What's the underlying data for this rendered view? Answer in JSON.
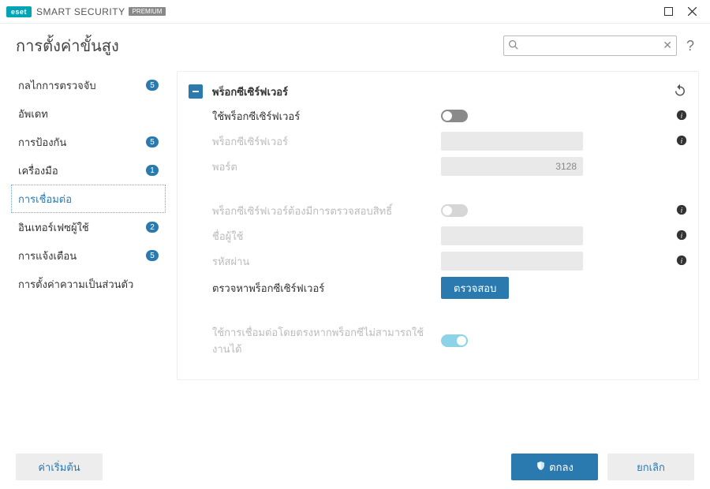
{
  "titlebar": {
    "logo": "eset",
    "product": "SMART SECURITY",
    "edition": "PREMIUM"
  },
  "header": {
    "title": "การตั้งค่าขั้นสูง",
    "search_placeholder": "",
    "help": "?"
  },
  "sidebar": {
    "items": [
      {
        "label": "กลไกการตรวจจับ",
        "badge": "5",
        "selected": false
      },
      {
        "label": "อัพเดท",
        "badge": null,
        "selected": false
      },
      {
        "label": "การป้องกัน",
        "badge": "5",
        "selected": false
      },
      {
        "label": "เครื่องมือ",
        "badge": "1",
        "selected": false
      },
      {
        "label": "การเชื่อมต่อ",
        "badge": null,
        "selected": true
      },
      {
        "label": "อินเทอร์เฟซผู้ใช้",
        "badge": "2",
        "selected": false
      },
      {
        "label": "การแจ้งเตือน",
        "badge": "5",
        "selected": false
      },
      {
        "label": "การตั้งค่าความเป็นส่วนตัว",
        "badge": null,
        "selected": false
      }
    ]
  },
  "section": {
    "title": "พร็อกซีเซิร์ฟเวอร์",
    "rows": {
      "use_proxy": {
        "label": "ใช้พร็อกซีเซิร์ฟเวอร์",
        "state": "off-dark"
      },
      "proxy_server": {
        "label": "พร็อกซีเซิร์ฟเวอร์",
        "value": ""
      },
      "port": {
        "label": "พอร์ต",
        "value": "3128"
      },
      "requires_auth": {
        "label": "พร็อกซีเซิร์ฟเวอร์ต้องมีการตรวจสอบสิทธิ์",
        "state": "off-light"
      },
      "username": {
        "label": "ชื่อผู้ใช้",
        "value": ""
      },
      "password": {
        "label": "รหัสผ่าน",
        "value": ""
      },
      "detect": {
        "label": "ตรวจหาพร็อกซีเซิร์ฟเวอร์",
        "button": "ตรวจสอบ"
      },
      "direct_fallback": {
        "label": "ใช้การเชื่อมต่อโดยตรงหากพร็อกซีไม่สามารถใช้งานได้",
        "state": "on-light"
      }
    }
  },
  "footer": {
    "defaults": "ค่าเริ่มต้น",
    "ok": "ตกลง",
    "cancel": "ยกเลิก"
  }
}
